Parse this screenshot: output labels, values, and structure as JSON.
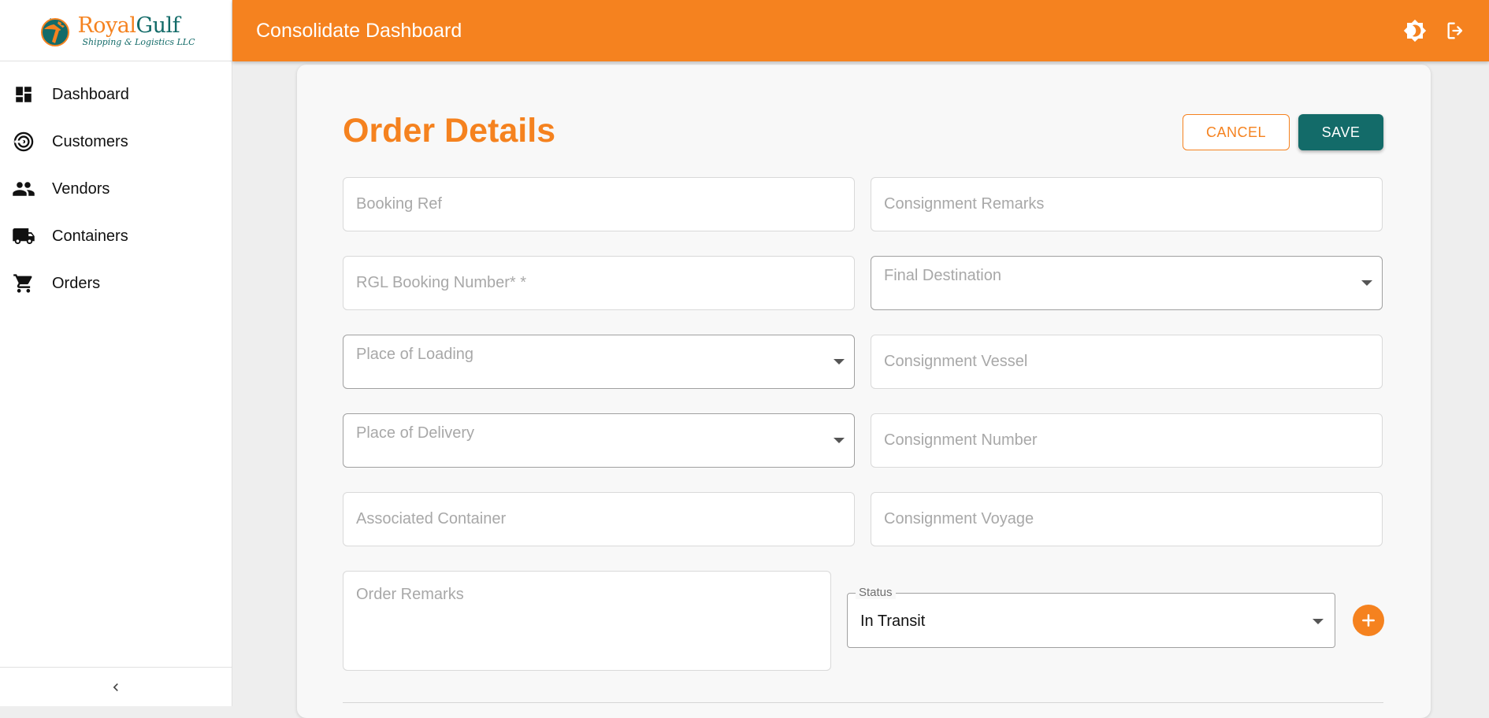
{
  "brand": {
    "name_part1": "Royal",
    "name_part2": "Gulf",
    "tagline": "Shipping & Logistics LLC"
  },
  "sidebar": {
    "items": [
      {
        "label": "Dashboard",
        "icon": "dashboard-icon"
      },
      {
        "label": "Customers",
        "icon": "customers-icon"
      },
      {
        "label": "Vendors",
        "icon": "people-icon"
      },
      {
        "label": "Containers",
        "icon": "truck-icon"
      },
      {
        "label": "Orders",
        "icon": "cart-icon"
      }
    ],
    "collapse_icon": "chevron-left-icon"
  },
  "header": {
    "title": "Consolidate Dashboard",
    "actions": [
      "theme-toggle-icon",
      "logout-icon"
    ]
  },
  "form": {
    "title": "Order Details",
    "cancel_label": "CANCEL",
    "save_label": "SAVE",
    "fields": {
      "booking_ref": {
        "placeholder": "Booking Ref",
        "value": ""
      },
      "consignment_remarks": {
        "placeholder": "Consignment Remarks",
        "value": ""
      },
      "rgl_booking_number": {
        "placeholder": "RGL Booking Number* *",
        "value": ""
      },
      "final_destination": {
        "label": "Final Destination",
        "value": ""
      },
      "place_of_loading": {
        "label": "Place of Loading",
        "value": ""
      },
      "consignment_vessel": {
        "placeholder": "Consignment Vessel",
        "value": ""
      },
      "place_of_delivery": {
        "label": "Place of Delivery",
        "value": ""
      },
      "consignment_number": {
        "placeholder": "Consignment Number",
        "value": ""
      },
      "associated_container": {
        "placeholder": "Associated Container",
        "value": ""
      },
      "consignment_voyage": {
        "placeholder": "Consignment Voyage",
        "value": ""
      },
      "order_remarks": {
        "placeholder": "Order Remarks",
        "value": ""
      },
      "status": {
        "label": "Status",
        "value": "In Transit"
      }
    },
    "add_icon": "plus-icon"
  },
  "colors": {
    "accent": "#f5821f",
    "primary": "#136b69",
    "background": "#eeeeee",
    "card": "#f8f8f8"
  }
}
